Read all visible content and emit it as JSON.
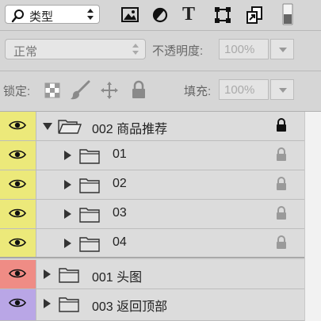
{
  "toolbar": {
    "filter_kind": "类型",
    "filter_icons": [
      "image-filter-icon",
      "adjustment-filter-icon",
      "type-filter-icon",
      "shape-filter-icon",
      "smart-object-filter-icon"
    ],
    "type_filter_glyph": "T"
  },
  "blend": {
    "mode": "正常",
    "opacity_label": "不透明度:",
    "opacity_value": "100%"
  },
  "lock": {
    "label": "锁定:",
    "fill_label": "填充:",
    "fill_value": "100%"
  },
  "colors": {
    "yellow": "#ece97a",
    "red": "#ef8c85",
    "purple": "#b9a6e6"
  },
  "layers": [
    {
      "name": "002 商品推荐",
      "color": "yellow",
      "expanded": true,
      "lock": "dark"
    },
    {
      "name": "01",
      "color": "yellow",
      "expanded": false,
      "lock": "light"
    },
    {
      "name": "02",
      "color": "yellow",
      "expanded": false,
      "lock": "light"
    },
    {
      "name": "03",
      "color": "yellow",
      "expanded": false,
      "lock": "light"
    },
    {
      "name": "04",
      "color": "yellow",
      "expanded": false,
      "lock": "light"
    },
    {
      "name": "001 头图",
      "color": "red",
      "expanded": false,
      "lock": "none"
    },
    {
      "name": "003 返回顶部",
      "color": "purple",
      "expanded": false,
      "lock": "none"
    }
  ]
}
